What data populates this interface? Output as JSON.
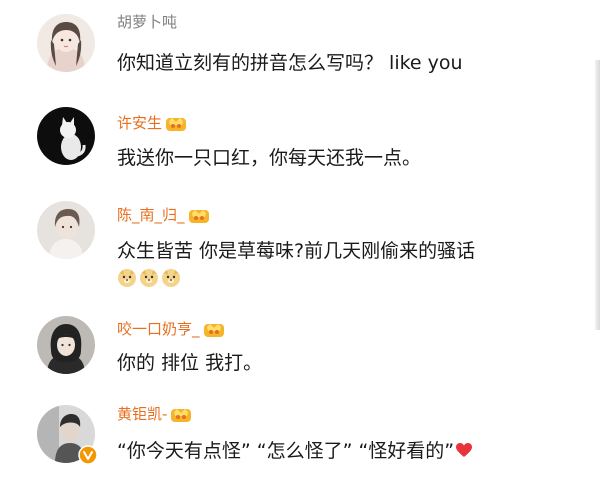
{
  "comments": [
    {
      "username": "胡萝卜吨",
      "text": "你知道立刻有的拼音怎么写吗？ like you",
      "is_vip": false
    },
    {
      "username": "许安生",
      "text": "我送你一只口红，你每天还我一点。",
      "is_vip": true
    },
    {
      "username": "陈_南_归_",
      "text": "众生皆苦 你是草莓味?前几天刚偷来的骚话",
      "is_vip": true
    },
    {
      "username": "咬一口奶亨_",
      "text": "你的 排位 我打。",
      "is_vip": true
    },
    {
      "username": "黄钜凯-",
      "text": "“你今天有点怪” “怎么怪了” “怪好看的”",
      "is_vip": true,
      "verified": true
    }
  ],
  "colors": {
    "vip_name": "#e86f1f",
    "plain_name": "#808080",
    "text": "#1a1a1a",
    "heart": "#e8333b",
    "verified": "#f39800"
  }
}
